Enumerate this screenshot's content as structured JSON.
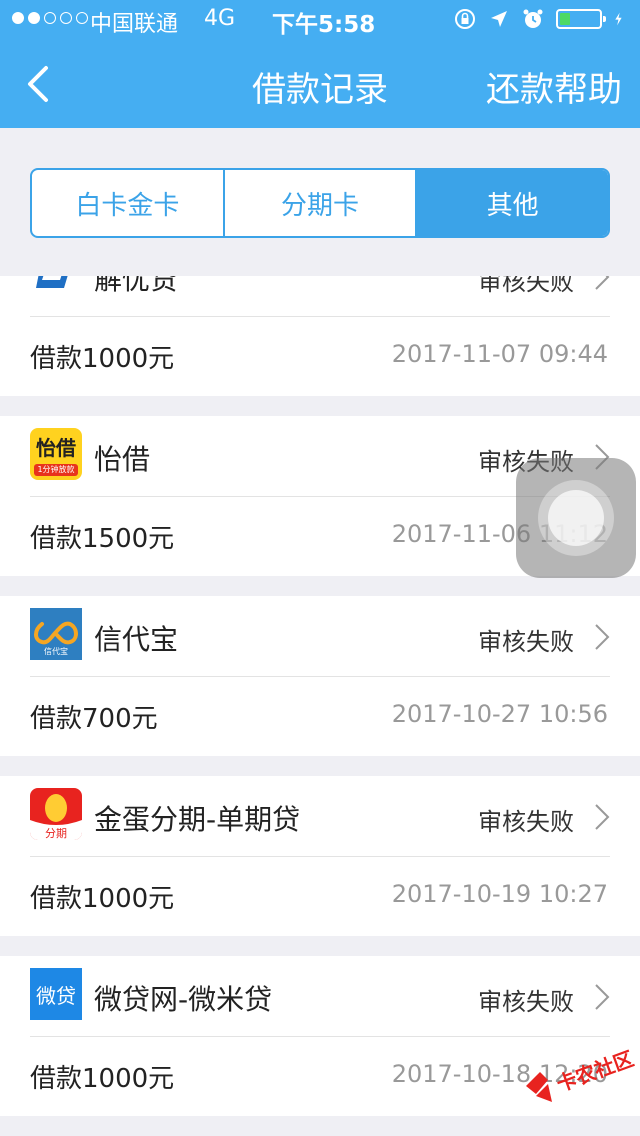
{
  "status_bar": {
    "signal_dots": 5,
    "signal_filled": 2,
    "carrier": "中国联通",
    "network": "4G",
    "time": "下午5:58",
    "icons": [
      "rotation-lock-icon",
      "location-arrow-icon",
      "alarm-icon",
      "battery-icon",
      "charging-bolt-icon"
    ],
    "battery_level": 0.25
  },
  "nav": {
    "back_icon": "chevron-left-icon",
    "title": "借款记录",
    "help_label": "还款帮助"
  },
  "tabs": [
    {
      "label": "白卡金卡",
      "active": false
    },
    {
      "label": "分期卡",
      "active": false
    },
    {
      "label": "其他",
      "active": true
    }
  ],
  "records": [
    {
      "name": "解忧贷",
      "status": "审核失败",
      "amount": "借款1000元",
      "date": "2017-11-07 09:44",
      "logo": "jieyoudai-logo"
    },
    {
      "name": "怡借",
      "status": "审核失败",
      "amount": "借款1500元",
      "date": "2017-11-06 11:12",
      "logo": "yijie-logo",
      "logo_text": "怡借",
      "logo_sub": "1分钟放款"
    },
    {
      "name": "信代宝",
      "status": "审核失败",
      "amount": "借款700元",
      "date": "2017-10-27 10:56",
      "logo": "xindaibao-logo",
      "logo_sub": "信代宝"
    },
    {
      "name": "金蛋分期-单期贷",
      "status": "审核失败",
      "amount": "借款1000元",
      "date": "2017-10-19 10:27",
      "logo": "jindan-logo",
      "logo_sub": "分期"
    },
    {
      "name": "微贷网-微米贷",
      "status": "审核失败",
      "amount": "借款1000元",
      "date": "2017-10-18 12:20",
      "logo": "weidai-logo",
      "logo_text": "微贷"
    }
  ],
  "colors": {
    "nav": "#45aef2",
    "accent": "#3ba3e8",
    "background": "#efeff4"
  },
  "watermark": "卡农社区"
}
